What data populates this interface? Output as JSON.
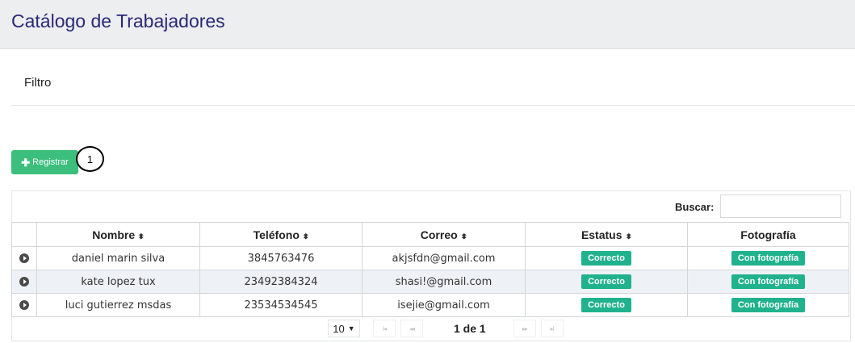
{
  "header": {
    "title": "Catálogo de Trabajadores"
  },
  "filter": {
    "label": "Filtro"
  },
  "toolbar": {
    "register_label": "Registrar",
    "register_icon": "plus-icon"
  },
  "annotation": {
    "marker": "1"
  },
  "search": {
    "label": "Buscar:",
    "value": "",
    "placeholder": ""
  },
  "table": {
    "columns": [
      "Nombre",
      "Teléfono",
      "Correo",
      "Estatus",
      "Fotografía"
    ],
    "rows": [
      {
        "nombre": "daniel marin silva",
        "telefono": "3845763476",
        "correo": "akjsfdn@gmail.com",
        "estatus": "Correcto",
        "fotografia": "Con fotografía"
      },
      {
        "nombre": "kate lopez tux",
        "telefono": "23492384324",
        "correo": "shasi!@gmail.com",
        "estatus": "Correcto",
        "fotografia": "Con fotografía"
      },
      {
        "nombre": "luci gutierrez msdas",
        "telefono": "23534534545",
        "correo": "isejie@gmail.com",
        "estatus": "Correcto",
        "fotografia": "Con fotografía"
      }
    ]
  },
  "pagination": {
    "page_size": "10",
    "page_info": "1 de 1",
    "first": "I◂",
    "prev": "◂◂",
    "next": "▸▸",
    "last": "▸I"
  },
  "colors": {
    "accent_green": "#3cbf7d",
    "badge_teal": "#20b28d",
    "title_blue": "#2a2877"
  }
}
